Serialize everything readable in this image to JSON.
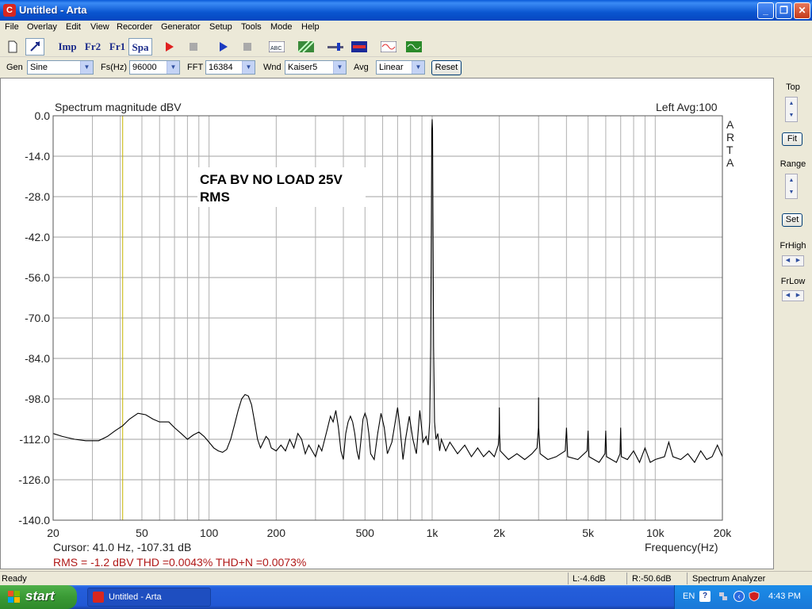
{
  "window": {
    "title": "Untitled - Arta",
    "app_icon_letter": "C"
  },
  "menu": [
    "File",
    "Overlay",
    "Edit",
    "View",
    "Recorder",
    "Generator",
    "Setup",
    "Tools",
    "Mode",
    "Help"
  ],
  "toolbar": {
    "imp_label": "Imp",
    "fr2_label": "Fr2",
    "fr1_label": "Fr1",
    "spa_label": "Spa"
  },
  "params": {
    "gen_label": "Gen",
    "gen_value": "Sine",
    "fs_label": "Fs(Hz)",
    "fs_value": "96000",
    "fft_label": "FFT",
    "fft_value": "16384",
    "wnd_label": "Wnd",
    "wnd_value": "Kaiser5",
    "avg_label": "Avg",
    "avg_value": "Linear",
    "reset_label": "Reset"
  },
  "plot": {
    "title": "Spectrum magnitude dBV",
    "channel_info": "Left  Avg:100",
    "annotation_line1": "CFA BV NO LOAD 25V",
    "annotation_line2": "RMS",
    "brand_letters": [
      "A",
      "R",
      "T",
      "A"
    ],
    "cursor_text": "Cursor:    41.0 Hz, -107.31 dB",
    "stats_text": "RMS =   -1.2 dBV   THD =0.0043%   THD+N =0.0073%",
    "xlabel": "Frequency(Hz)"
  },
  "chart_data": {
    "type": "line",
    "title": "Spectrum magnitude dBV",
    "xlabel": "Frequency(Hz)",
    "ylabel": "",
    "xscale": "log",
    "xlim": [
      20,
      20000
    ],
    "ylim": [
      -140,
      0
    ],
    "grid": true,
    "yticks": [
      "0.0",
      "-14.0",
      "-28.0",
      "-42.0",
      "-56.0",
      "-70.0",
      "-84.0",
      "-98.0",
      "-112.0",
      "-126.0",
      "-140.0"
    ],
    "xticks": [
      {
        "value": 20,
        "label": "20"
      },
      {
        "value": 50,
        "label": "50"
      },
      {
        "value": 100,
        "label": "100"
      },
      {
        "value": 200,
        "label": "200"
      },
      {
        "value": 500,
        "label": "500"
      },
      {
        "value": 1000,
        "label": "1k"
      },
      {
        "value": 2000,
        "label": "2k"
      },
      {
        "value": 5000,
        "label": "5k"
      },
      {
        "value": 10000,
        "label": "10k"
      },
      {
        "value": 20000,
        "label": "20k"
      }
    ],
    "cursor_x": 41.0,
    "series": [
      {
        "color": "#000000",
        "points": [
          [
            20,
            -110
          ],
          [
            22,
            -111
          ],
          [
            25,
            -112
          ],
          [
            28,
            -112.5
          ],
          [
            32,
            -112.5
          ],
          [
            35,
            -111
          ],
          [
            38,
            -109
          ],
          [
            41,
            -107.3
          ],
          [
            44,
            -105
          ],
          [
            48,
            -103
          ],
          [
            52,
            -103.5
          ],
          [
            56,
            -105
          ],
          [
            60,
            -106
          ],
          [
            66,
            -106
          ],
          [
            70,
            -108
          ],
          [
            75,
            -110
          ],
          [
            80,
            -112
          ],
          [
            85,
            -110.5
          ],
          [
            90,
            -109.5
          ],
          [
            95,
            -111
          ],
          [
            100,
            -113
          ],
          [
            105,
            -115
          ],
          [
            110,
            -116
          ],
          [
            115,
            -116.5
          ],
          [
            120,
            -115.5
          ],
          [
            125,
            -112
          ],
          [
            130,
            -107
          ],
          [
            135,
            -102
          ],
          [
            140,
            -98
          ],
          [
            145,
            -96.5
          ],
          [
            150,
            -97
          ],
          [
            155,
            -100
          ],
          [
            160,
            -106
          ],
          [
            165,
            -112
          ],
          [
            170,
            -115
          ],
          [
            175,
            -113
          ],
          [
            180,
            -111
          ],
          [
            185,
            -112
          ],
          [
            190,
            -115
          ],
          [
            200,
            -116
          ],
          [
            210,
            -114
          ],
          [
            220,
            -116
          ],
          [
            230,
            -112
          ],
          [
            240,
            -115
          ],
          [
            250,
            -110
          ],
          [
            260,
            -112
          ],
          [
            270,
            -117
          ],
          [
            280,
            -114
          ],
          [
            290,
            -116
          ],
          [
            300,
            -118
          ],
          [
            310,
            -114
          ],
          [
            320,
            -116
          ],
          [
            330,
            -112
          ],
          [
            340,
            -108
          ],
          [
            350,
            -104
          ],
          [
            360,
            -106
          ],
          [
            370,
            -102
          ],
          [
            380,
            -108
          ],
          [
            390,
            -116
          ],
          [
            400,
            -119
          ],
          [
            410,
            -110
          ],
          [
            420,
            -106
          ],
          [
            430,
            -104
          ],
          [
            440,
            -106
          ],
          [
            450,
            -110
          ],
          [
            460,
            -116
          ],
          [
            470,
            -119
          ],
          [
            480,
            -112
          ],
          [
            490,
            -105
          ],
          [
            500,
            -103
          ],
          [
            510,
            -105
          ],
          [
            520,
            -110
          ],
          [
            530,
            -117
          ],
          [
            550,
            -119
          ],
          [
            570,
            -110
          ],
          [
            590,
            -103
          ],
          [
            610,
            -108
          ],
          [
            630,
            -117
          ],
          [
            660,
            -113
          ],
          [
            700,
            -101
          ],
          [
            720,
            -109
          ],
          [
            740,
            -119
          ],
          [
            760,
            -112
          ],
          [
            790,
            -104
          ],
          [
            820,
            -112
          ],
          [
            850,
            -117
          ],
          [
            880,
            -102
          ],
          [
            910,
            -113
          ],
          [
            940,
            -111
          ],
          [
            960,
            -114
          ],
          [
            975,
            -106
          ],
          [
            985,
            -80
          ],
          [
            992,
            -35
          ],
          [
            996,
            -5
          ],
          [
            1000,
            -1.2
          ],
          [
            1004,
            -5
          ],
          [
            1008,
            -35
          ],
          [
            1015,
            -80
          ],
          [
            1025,
            -106
          ],
          [
            1040,
            -112
          ],
          [
            1060,
            -110
          ],
          [
            1080,
            -116
          ],
          [
            1100,
            -112
          ],
          [
            1150,
            -116
          ],
          [
            1200,
            -113
          ],
          [
            1300,
            -117
          ],
          [
            1400,
            -114
          ],
          [
            1500,
            -118
          ],
          [
            1600,
            -115
          ],
          [
            1700,
            -118
          ],
          [
            1800,
            -116
          ],
          [
            1900,
            -118
          ],
          [
            1980,
            -114
          ],
          [
            1995,
            -110
          ],
          [
            2000,
            -101
          ],
          [
            2005,
            -110
          ],
          [
            2020,
            -116
          ],
          [
            2200,
            -119
          ],
          [
            2400,
            -117
          ],
          [
            2600,
            -119
          ],
          [
            2800,
            -117
          ],
          [
            2950,
            -115
          ],
          [
            2995,
            -108
          ],
          [
            3000,
            -97.5
          ],
          [
            3005,
            -108
          ],
          [
            3050,
            -117
          ],
          [
            3300,
            -119
          ],
          [
            3600,
            -118
          ],
          [
            3950,
            -116
          ],
          [
            4000,
            -108
          ],
          [
            4050,
            -118
          ],
          [
            4500,
            -119
          ],
          [
            4950,
            -116
          ],
          [
            5000,
            -109
          ],
          [
            5050,
            -118
          ],
          [
            5600,
            -120
          ],
          [
            5950,
            -117
          ],
          [
            6000,
            -109
          ],
          [
            6050,
            -118
          ],
          [
            6700,
            -120
          ],
          [
            6950,
            -117
          ],
          [
            7000,
            -108
          ],
          [
            7050,
            -118
          ],
          [
            7500,
            -119
          ],
          [
            8000,
            -116
          ],
          [
            8500,
            -120
          ],
          [
            9000,
            -115
          ],
          [
            9500,
            -120
          ],
          [
            10000,
            -119
          ],
          [
            11000,
            -118
          ],
          [
            11500,
            -113
          ],
          [
            12000,
            -118
          ],
          [
            13000,
            -119
          ],
          [
            14000,
            -117
          ],
          [
            15000,
            -120
          ],
          [
            16000,
            -116
          ],
          [
            17000,
            -119
          ],
          [
            18000,
            -118
          ],
          [
            19000,
            -114
          ],
          [
            20000,
            -118
          ]
        ]
      }
    ]
  },
  "right_panel": {
    "top_label": "Top",
    "fit_label": "Fit",
    "range_label": "Range",
    "set_label": "Set",
    "frhigh_label": "FrHigh",
    "frlow_label": "FrLow"
  },
  "status": {
    "ready": "Ready",
    "left_level": "L:-4.6dB",
    "right_level": "R:-50.6dB",
    "mode": "Spectrum Analyzer"
  },
  "taskbar": {
    "start_label": "start",
    "task_label": "Untitled - Arta",
    "lang": "EN",
    "clock": "4:43 PM"
  },
  "colors": {
    "grid": "#a0a0a0",
    "cursor": "#c8b400",
    "accent_red": "#b01818",
    "titlebar": "#0a56d0"
  }
}
